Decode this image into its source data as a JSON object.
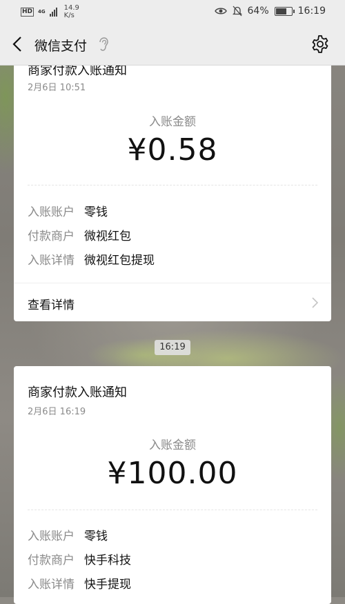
{
  "status_bar": {
    "network_hd": "HD",
    "network_type": "4G",
    "speed_value": "14.9",
    "speed_unit": "K/s",
    "battery": "64%",
    "time": "16:19"
  },
  "header": {
    "title": "微信支付"
  },
  "cards": [
    {
      "title": "商家付款入账通知",
      "date": "2月6日  10:51",
      "amount_label": "入账金额",
      "amount": "¥0.58",
      "rows": [
        {
          "key": "入账账户",
          "value": "零钱"
        },
        {
          "key": "付款商户",
          "value": "微视红包"
        },
        {
          "key": "入账详情",
          "value": "微视红包提现"
        }
      ],
      "details_link": "查看详情"
    },
    {
      "title": "商家付款入账通知",
      "date": "2月6日  16:19",
      "amount_label": "入账金额",
      "amount": "¥100.00",
      "rows": [
        {
          "key": "入账账户",
          "value": "零钱"
        },
        {
          "key": "付款商户",
          "value": "快手科技"
        },
        {
          "key": "入账详情",
          "value": "快手提现"
        }
      ]
    }
  ],
  "time_divider": "16:19",
  "colors": {
    "bar_bg": "#ededed",
    "card_bg": "#ffffff",
    "muted_text": "#8a8a8a",
    "primary_text": "#111111"
  }
}
